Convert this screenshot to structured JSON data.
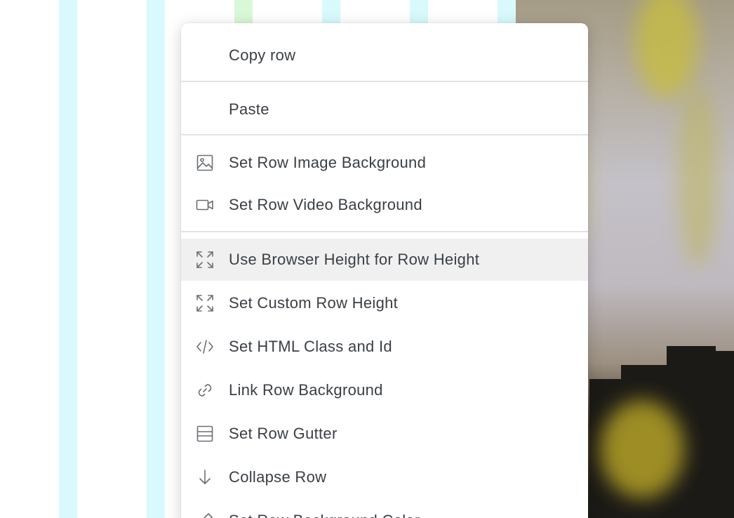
{
  "menu": {
    "items": [
      {
        "label": "Copy row",
        "icon": "none"
      },
      {
        "label": "Paste",
        "icon": "none"
      },
      {
        "label": "Set Row Image Background",
        "icon": "image-icon"
      },
      {
        "label": "Set Row Video Background",
        "icon": "video-camera-icon"
      },
      {
        "label": "Use Browser Height for Row Height",
        "icon": "expand-icon"
      },
      {
        "label": "Set Custom Row Height",
        "icon": "expand-icon"
      },
      {
        "label": "Set HTML Class and Id",
        "icon": "code-icon"
      },
      {
        "label": "Link Row Background",
        "icon": "link-icon"
      },
      {
        "label": "Set Row Gutter",
        "icon": "gutter-icon"
      },
      {
        "label": "Collapse Row",
        "icon": "arrow-down-icon"
      },
      {
        "label": "Set Row Background Color",
        "icon": "pencil-icon"
      }
    ],
    "active_item": "Use Browser Height for Row Height"
  },
  "colors": {
    "guide_cyan": "#d8fafc",
    "guide_green": "#d9f8d7",
    "menu_text": "#3a3f45",
    "icon_stroke": "#6a6f75",
    "active_bg": "#f0f0f0",
    "divider": "#e2e3e5"
  }
}
